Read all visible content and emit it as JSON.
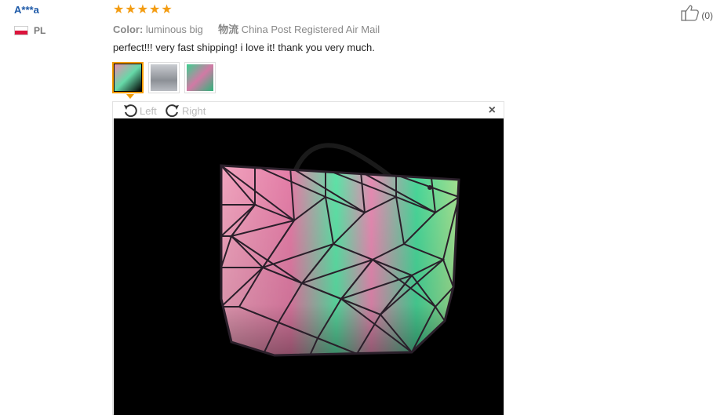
{
  "reviewer": {
    "name": "A***a",
    "country": "PL"
  },
  "rating": {
    "stars": 5,
    "max": 5
  },
  "attributes": {
    "color_label": "Color:",
    "color_value": "luminous big",
    "shipping_label": "物流",
    "shipping_value": "China Post Registered Air Mail"
  },
  "review": {
    "text": "perfect!!! very fast shipping! i love it! thank you very much."
  },
  "thumbnails": [
    {
      "id": "photo-1",
      "selected": true
    },
    {
      "id": "photo-2",
      "selected": false
    },
    {
      "id": "photo-3",
      "selected": false
    }
  ],
  "viewer": {
    "rotate_left_label": "Left",
    "rotate_right_label": "Right",
    "close_symbol": "×"
  },
  "helpful": {
    "count_text": "(0)"
  },
  "colors": {
    "accent": "#f29b00",
    "star": "#f39c12",
    "name": "#1e5aa8"
  }
}
